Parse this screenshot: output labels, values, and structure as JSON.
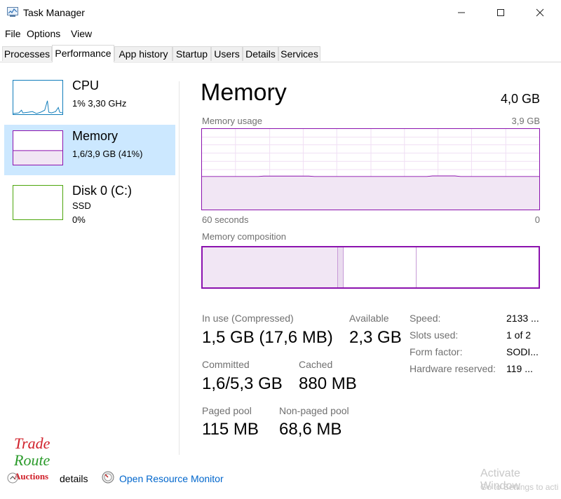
{
  "window": {
    "title": "Task Manager"
  },
  "menu": {
    "items": [
      "File",
      "Options",
      "View"
    ]
  },
  "tabs": [
    "Processes",
    "Performance",
    "App history",
    "Startup",
    "Users",
    "Details",
    "Services"
  ],
  "active_tab": "Performance",
  "left_pane": [
    {
      "title": "CPU",
      "sub1": "1%  3,30 GHz",
      "sub2": "",
      "color": "#117dbb"
    },
    {
      "title": "Memory",
      "sub1": "1,6/3,9 GB (41%)",
      "sub2": "",
      "color": "#8b12ae"
    },
    {
      "title": "Disk 0 (C:)",
      "sub1": "SSD",
      "sub2": "0%",
      "color": "#4da60c"
    }
  ],
  "main": {
    "title": "Memory",
    "total": "4,0 GB",
    "usage_label": "Memory usage",
    "usage_max": "3,9 GB",
    "time_left": "60 seconds",
    "time_right": "0",
    "composition_label": "Memory composition",
    "usage_fraction": 0.41,
    "composition": {
      "in_use": 0.4,
      "modified": 0.015,
      "standby": 0.22
    },
    "stats": {
      "in_use_label": "In use (Compressed)",
      "in_use_value": "1,5 GB (17,6 MB)",
      "available_label": "Available",
      "available_value": "2,3 GB",
      "committed_label": "Committed",
      "committed_value": "1,6/5,3 GB",
      "cached_label": "Cached",
      "cached_value": "880 MB",
      "paged_label": "Paged pool",
      "paged_value": "115 MB",
      "nonpaged_label": "Non-paged pool",
      "nonpaged_value": "68,6 MB"
    },
    "specs": [
      {
        "label": "Speed:",
        "value": "2133 ..."
      },
      {
        "label": "Slots used:",
        "value": "1 of 2"
      },
      {
        "label": "Form factor:",
        "value": "SODI..."
      },
      {
        "label": "Hardware reserved:",
        "value": "119 ..."
      }
    ]
  },
  "bottom": {
    "fewer_details": "details",
    "open_monitor": "Open Resource Monitor",
    "watermark_1": "Activate Window",
    "watermark_2": "Go to Settings to acti",
    "logo_line1": "Trade",
    "logo_line2": "Route",
    "logo_line3": "Auctions"
  },
  "colors": {
    "memory": "#8b12ae",
    "cpu": "#117dbb",
    "disk": "#4da60c",
    "selected": "#cce8ff",
    "link": "#0066cc"
  }
}
